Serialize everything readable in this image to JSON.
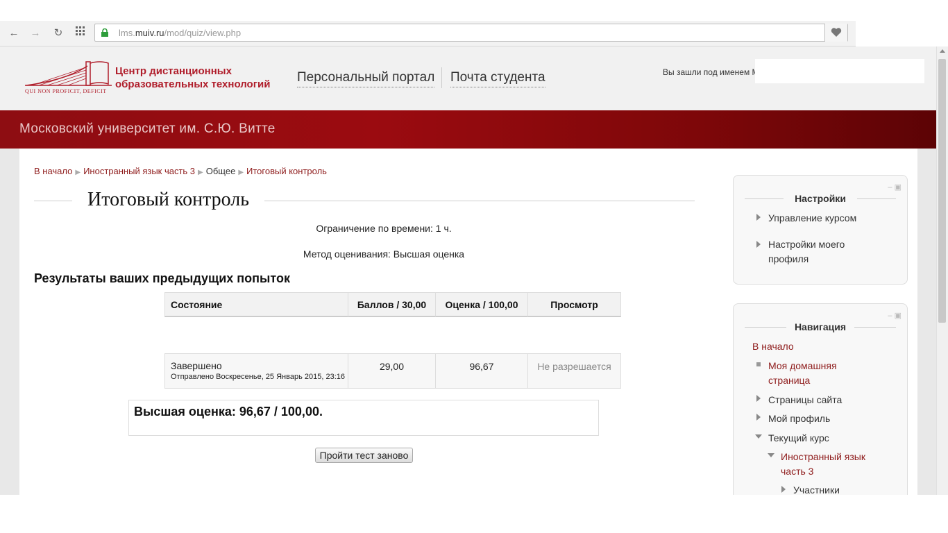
{
  "browser": {
    "url_prefix": "lms.",
    "url_domain": "muiv.ru",
    "url_path": "/mod/quiz/view.php"
  },
  "header": {
    "logo_line1": "Центр дистанционных",
    "logo_line2": "образовательных технологий",
    "logo_motto": "QUI NON PROFICIT, DEFICIT",
    "nav_portal": "Персональный портал",
    "nav_mail": "Почта студента",
    "login_text": "Вы зашли под именем М"
  },
  "banner": {
    "title": "Московский университет им. С.Ю. Витте"
  },
  "breadcrumb": {
    "home": "В начало",
    "course": "Иностранный язык часть 3",
    "section": "Общее",
    "current": "Итоговый контроль"
  },
  "quiz": {
    "title": "Итоговый контроль",
    "time_limit": "Ограничение по времени: 1 ч.",
    "grading_method": "Метод оценивания: Высшая оценка",
    "results_heading": "Результаты ваших предыдущих попыток",
    "columns": {
      "state": "Состояние",
      "marks": "Баллов / 30,00",
      "grade": "Оценка / 100,00",
      "review": "Просмотр"
    },
    "attempt": {
      "state": "Завершено",
      "submitted": "Отправлено Воскресенье, 25 Январь 2015, 23:16",
      "marks": "29,00",
      "grade": "96,67",
      "review": "Не разрешается"
    },
    "best_grade": "Высшая оценка: 96,67 / 100,00.",
    "retry_label": "Пройти тест заново"
  },
  "settings_block": {
    "title": "Настройки",
    "items": [
      "Управление курсом",
      "Настройки моего",
      "профиля"
    ]
  },
  "nav_block": {
    "title": "Навигация",
    "home": "В начало",
    "my_home_1": "Моя домашняя",
    "my_home_2": "страница",
    "site_pages": "Страницы сайта",
    "my_profile": "Мой профиль",
    "current_course": "Текущий курс",
    "course_1": "Иностранный язык",
    "course_2": "часть 3",
    "participants": "Участники"
  },
  "colors": {
    "accent": "#8e1b1b",
    "banner": "#8e0d12"
  }
}
